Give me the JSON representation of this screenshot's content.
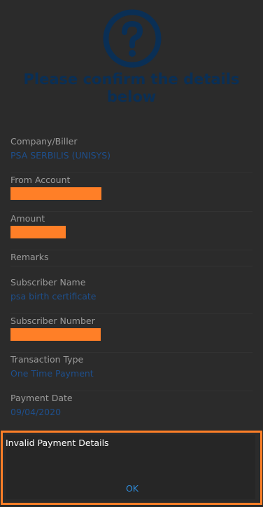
{
  "confirm": {
    "icon": "question-mark-icon",
    "title_line1": "Please confirm the details",
    "title_line2": "below"
  },
  "fields": [
    {
      "label": "Company/Biller",
      "value": "PSA SERBILIS (UNISYS)"
    },
    {
      "label": "From Account",
      "value": "",
      "redacted": true
    },
    {
      "label": "Amount",
      "value": "",
      "redacted": true
    },
    {
      "label": "Remarks",
      "value": ""
    },
    {
      "label": "Subscriber Name",
      "value": "psa birth certificate"
    },
    {
      "label": "Subscriber Number",
      "value": "",
      "redacted": true
    },
    {
      "label": "Transaction Type",
      "value": "One Time Payment"
    },
    {
      "label": "Payment Date",
      "value": "09/04/2020"
    }
  ],
  "dialog": {
    "message": "Invalid Payment Details",
    "ok_label": "OK"
  },
  "colors": {
    "background": "#2b2b2b",
    "title": "#0a2f55",
    "value": "#1e4f8c",
    "label": "#9b9b9b",
    "redaction": "#ff7f27",
    "dialog_bg": "#262626",
    "button": "#2f8bd9"
  }
}
